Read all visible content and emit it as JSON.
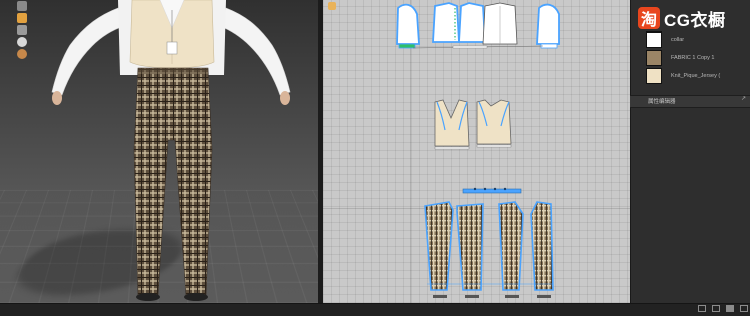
{
  "brand": {
    "icon_glyph": "淘",
    "title": "CG衣橱",
    "accent": "#e8461e"
  },
  "fabric_list": [
    {
      "name": "",
      "color": "#f1ece2"
    },
    {
      "name": "collar",
      "color": "#ffffff"
    },
    {
      "name": "FABRIC 1 Copy 1",
      "color": "#9b8566"
    },
    {
      "name": "Knit_Pique_Jersey (",
      "color": "#efe1c4"
    }
  ],
  "property_editor": {
    "title": "属性编辑器",
    "close_glyph": "↗"
  },
  "garment": {
    "vest_color": "#efe2c6",
    "shirt_color": "#ffffff",
    "pant_color": "#6b5a45",
    "selection_color": "#4aa3ff"
  }
}
